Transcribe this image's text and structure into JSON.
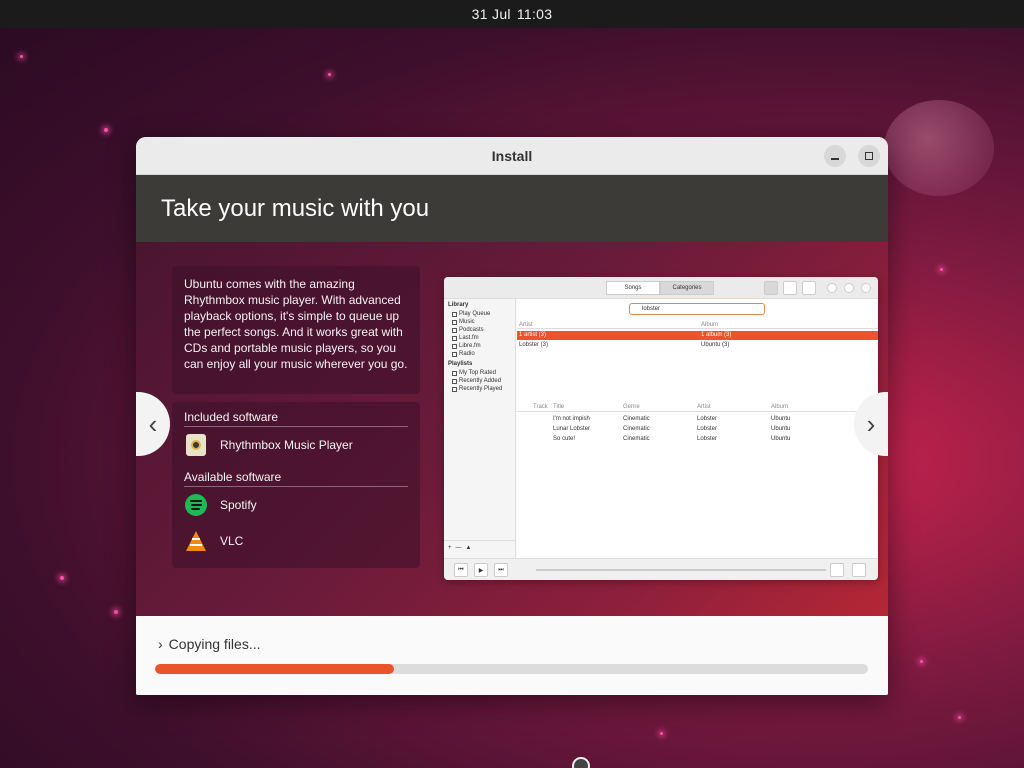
{
  "topbar": {
    "date": "31 Jul",
    "time": "11:03"
  },
  "window": {
    "title": "Install",
    "minimize_icon": "minimize-icon",
    "maximize_icon": "maximize-icon"
  },
  "slide": {
    "heading": "Take your music with you",
    "description": "Ubuntu comes with the amazing Rhythmbox music player. With advanced playback options, it's simple to queue up the perfect songs. And it works great with CDs and portable music players, so you can enjoy all your music wherever you go.",
    "included_heading": "Included software",
    "included": [
      {
        "label": "Rhythmbox Music Player",
        "icon": "rhythmbox-icon"
      }
    ],
    "available_heading": "Available software",
    "available": [
      {
        "label": "Spotify",
        "icon": "spotify-icon"
      },
      {
        "label": "VLC",
        "icon": "vlc-icon"
      }
    ],
    "prev_label": "‹",
    "next_label": "›"
  },
  "screenshot": {
    "tabs": [
      "Songs",
      "Categories"
    ],
    "library_heading": "Library",
    "library_items": [
      "Play Queue",
      "Music",
      "Podcasts",
      "Last.fm",
      "Libre.fm",
      "Radio"
    ],
    "playlists_heading": "Playlists",
    "playlist_items": [
      "My Top Rated",
      "Recently Added",
      "Recently Played"
    ],
    "search_value": "lobster",
    "artist_col": "Artist",
    "album_col": "Album",
    "artist_rows": [
      {
        "artist": "1 artist (3)",
        "album": "1 album (3)"
      },
      {
        "artist": "Lobster (3)",
        "album": "Ubuntu (3)"
      }
    ],
    "track_cols": [
      "Track",
      "Title",
      "Genre",
      "Artist",
      "Album"
    ],
    "tracks": [
      {
        "title": "I'm not impish",
        "genre": "Cinematic",
        "artist": "Lobster",
        "album": "Ubuntu"
      },
      {
        "title": "Lunar Lobster",
        "genre": "Cinematic",
        "artist": "Lobster",
        "album": "Ubuntu"
      },
      {
        "title": "So cute!",
        "genre": "Cinematic",
        "artist": "Lobster",
        "album": "Ubuntu"
      }
    ],
    "playback": {
      "prev": "⏮",
      "play": "▶",
      "next": "⏭"
    },
    "sidebar_btns": [
      "+",
      "—",
      "▲"
    ]
  },
  "progress": {
    "label": "Copying files...",
    "expand_icon": "chevron-right-icon",
    "percent": 33.5,
    "fill_color": "#e9542b"
  }
}
